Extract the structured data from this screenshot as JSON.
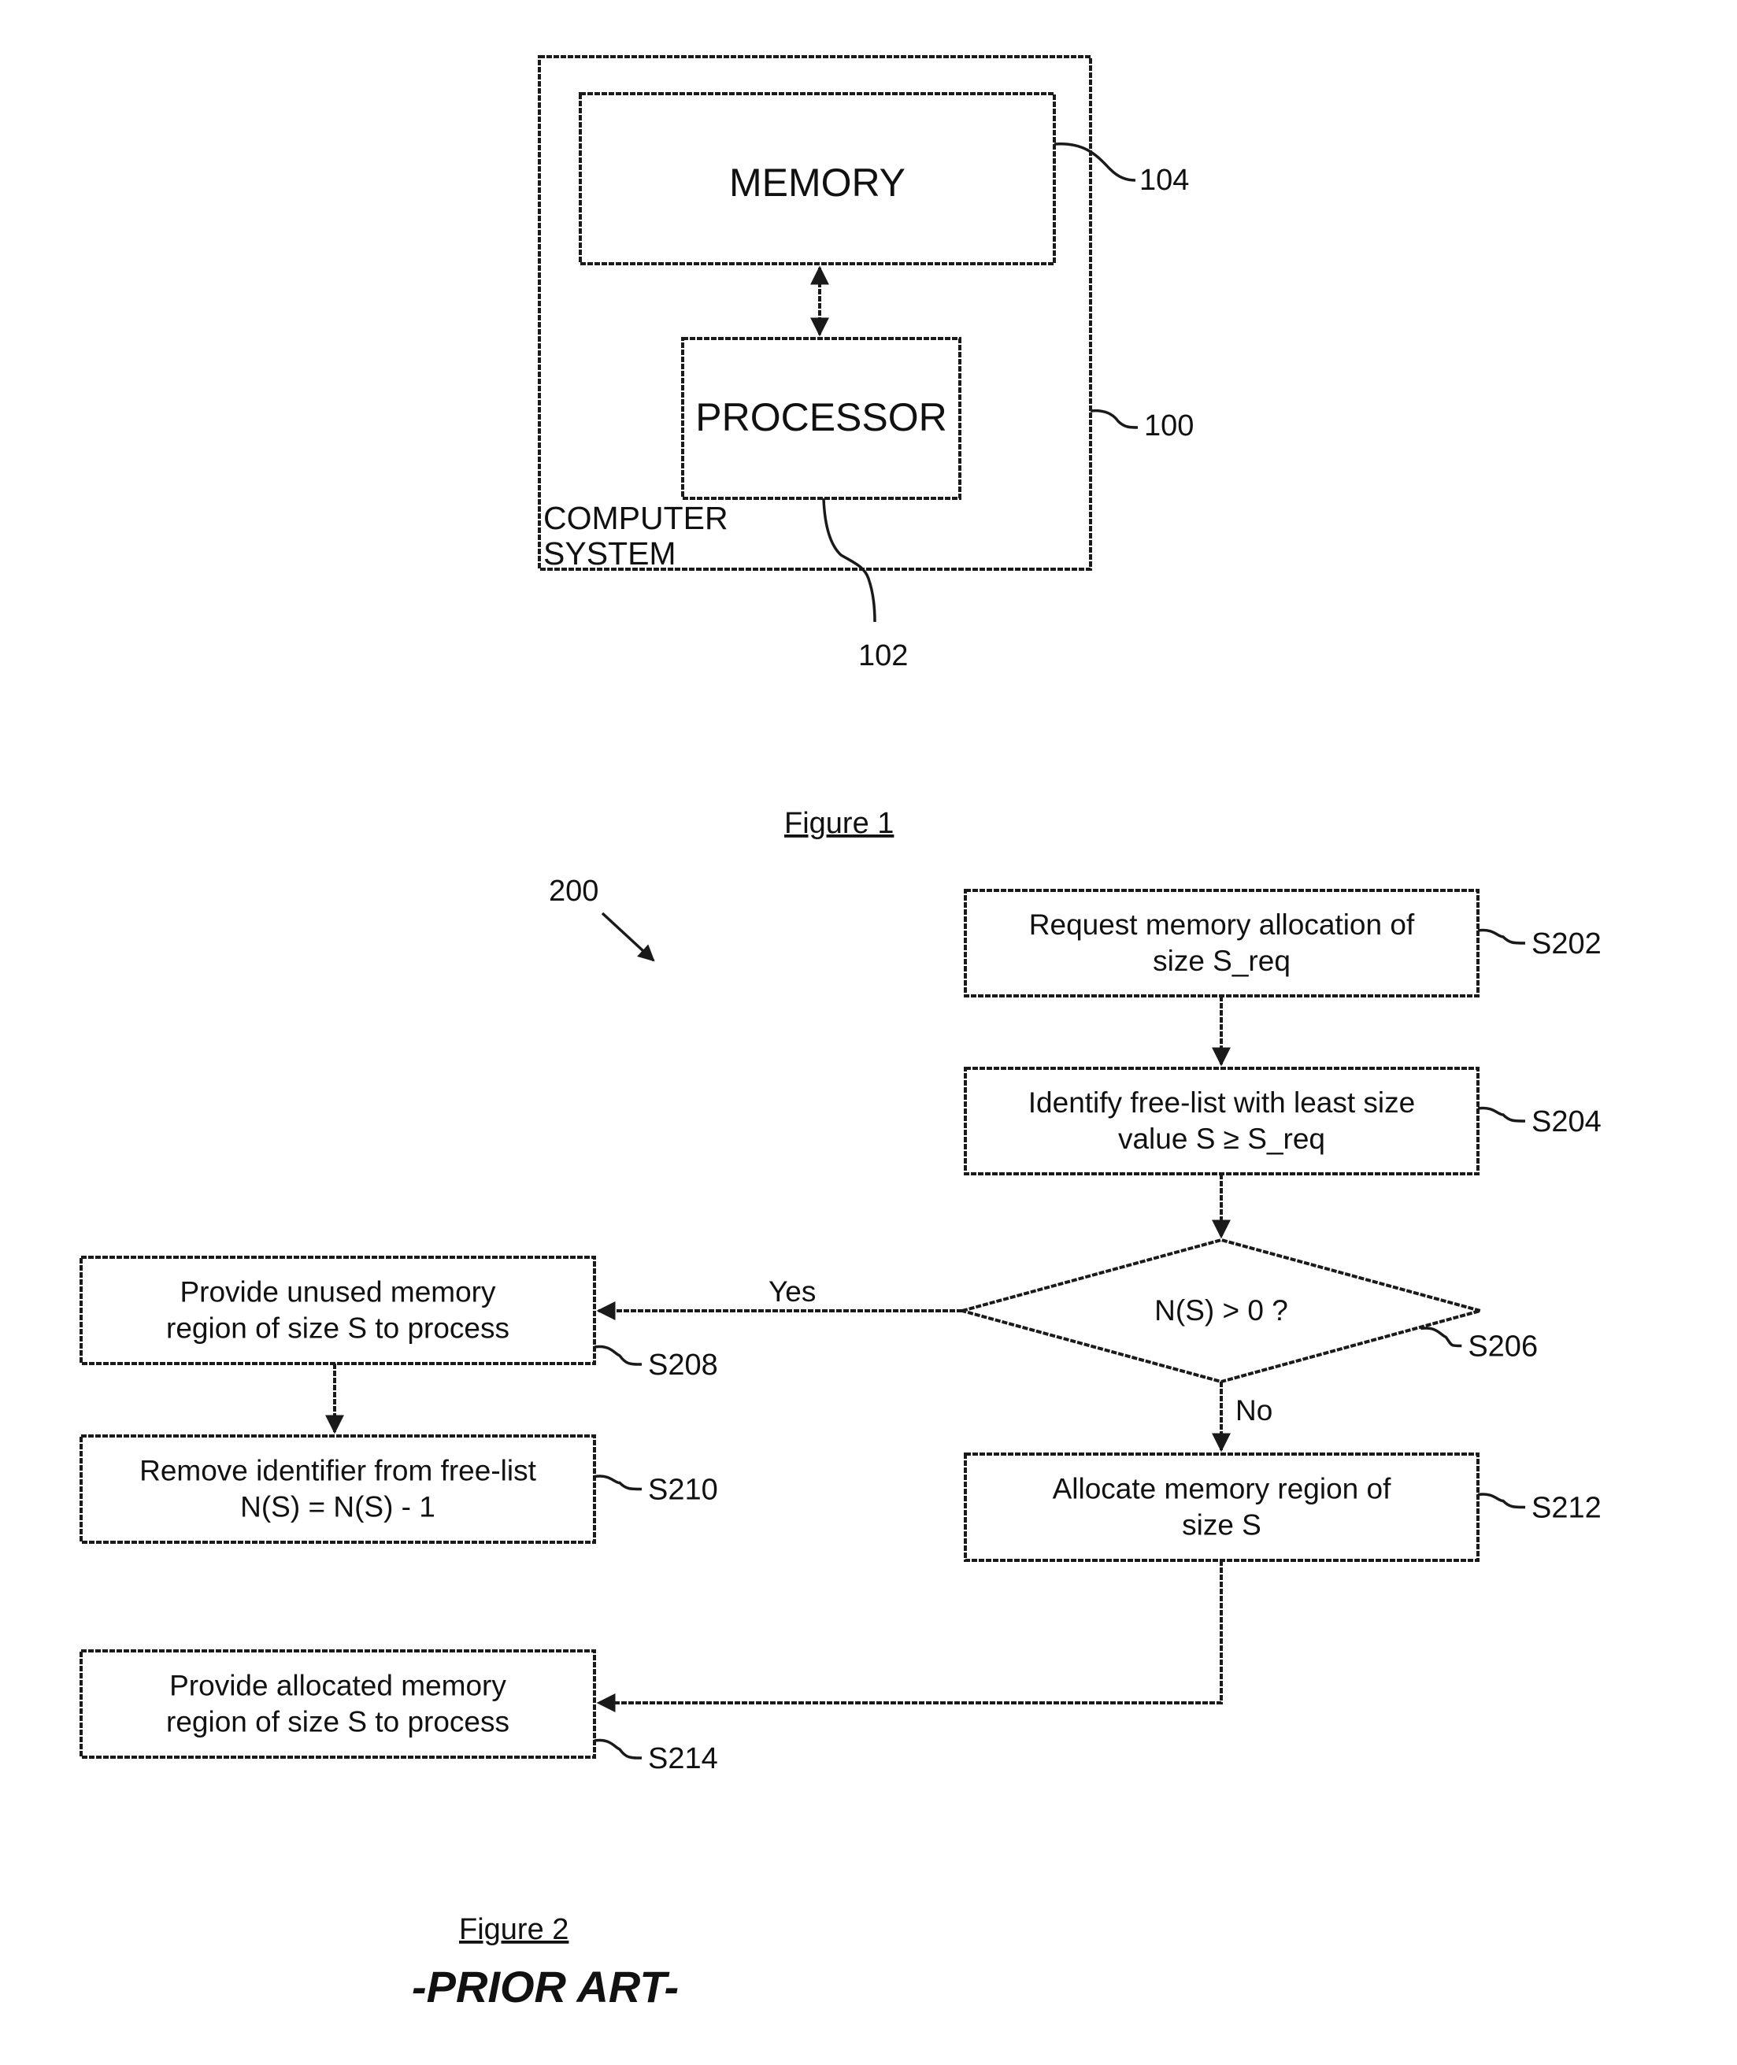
{
  "figure1": {
    "caption": "Figure 1",
    "system": {
      "ref": "100",
      "label_lines": [
        "COMPUTER",
        "SYSTEM"
      ]
    },
    "memory": {
      "label": "MEMORY",
      "ref": "104"
    },
    "processor": {
      "label": "PROCESSOR",
      "ref": "102"
    }
  },
  "figure2": {
    "caption": "Figure 2",
    "note": "-PRIOR ART-",
    "ref": "200",
    "steps": [
      {
        "id": "S202",
        "kind": "process",
        "lines": [
          "Request memory allocation of",
          "size S_req"
        ]
      },
      {
        "id": "S204",
        "kind": "process",
        "lines": [
          "Identify free-list with least size",
          "value S ≥ S_req"
        ]
      },
      {
        "id": "S206",
        "kind": "decision",
        "lines": [
          "N(S) > 0 ?"
        ]
      },
      {
        "id": "S208",
        "kind": "process",
        "lines": [
          "Provide unused memory",
          "region of size S to process"
        ]
      },
      {
        "id": "S210",
        "kind": "process",
        "lines": [
          "Remove identifier from free-list",
          "N(S) = N(S) - 1"
        ]
      },
      {
        "id": "S212",
        "kind": "process",
        "lines": [
          "Allocate memory region of",
          "size S"
        ]
      },
      {
        "id": "S214",
        "kind": "process",
        "lines": [
          "Provide allocated memory",
          "region of size S to process"
        ]
      }
    ],
    "edges": [
      {
        "from": "S202",
        "to": "S204",
        "label": ""
      },
      {
        "from": "S204",
        "to": "S206",
        "label": ""
      },
      {
        "from": "S206",
        "to": "S208",
        "label": "Yes"
      },
      {
        "from": "S206",
        "to": "S212",
        "label": "No"
      },
      {
        "from": "S208",
        "to": "S210",
        "label": ""
      },
      {
        "from": "S212",
        "to": "S214",
        "label": ""
      }
    ]
  }
}
